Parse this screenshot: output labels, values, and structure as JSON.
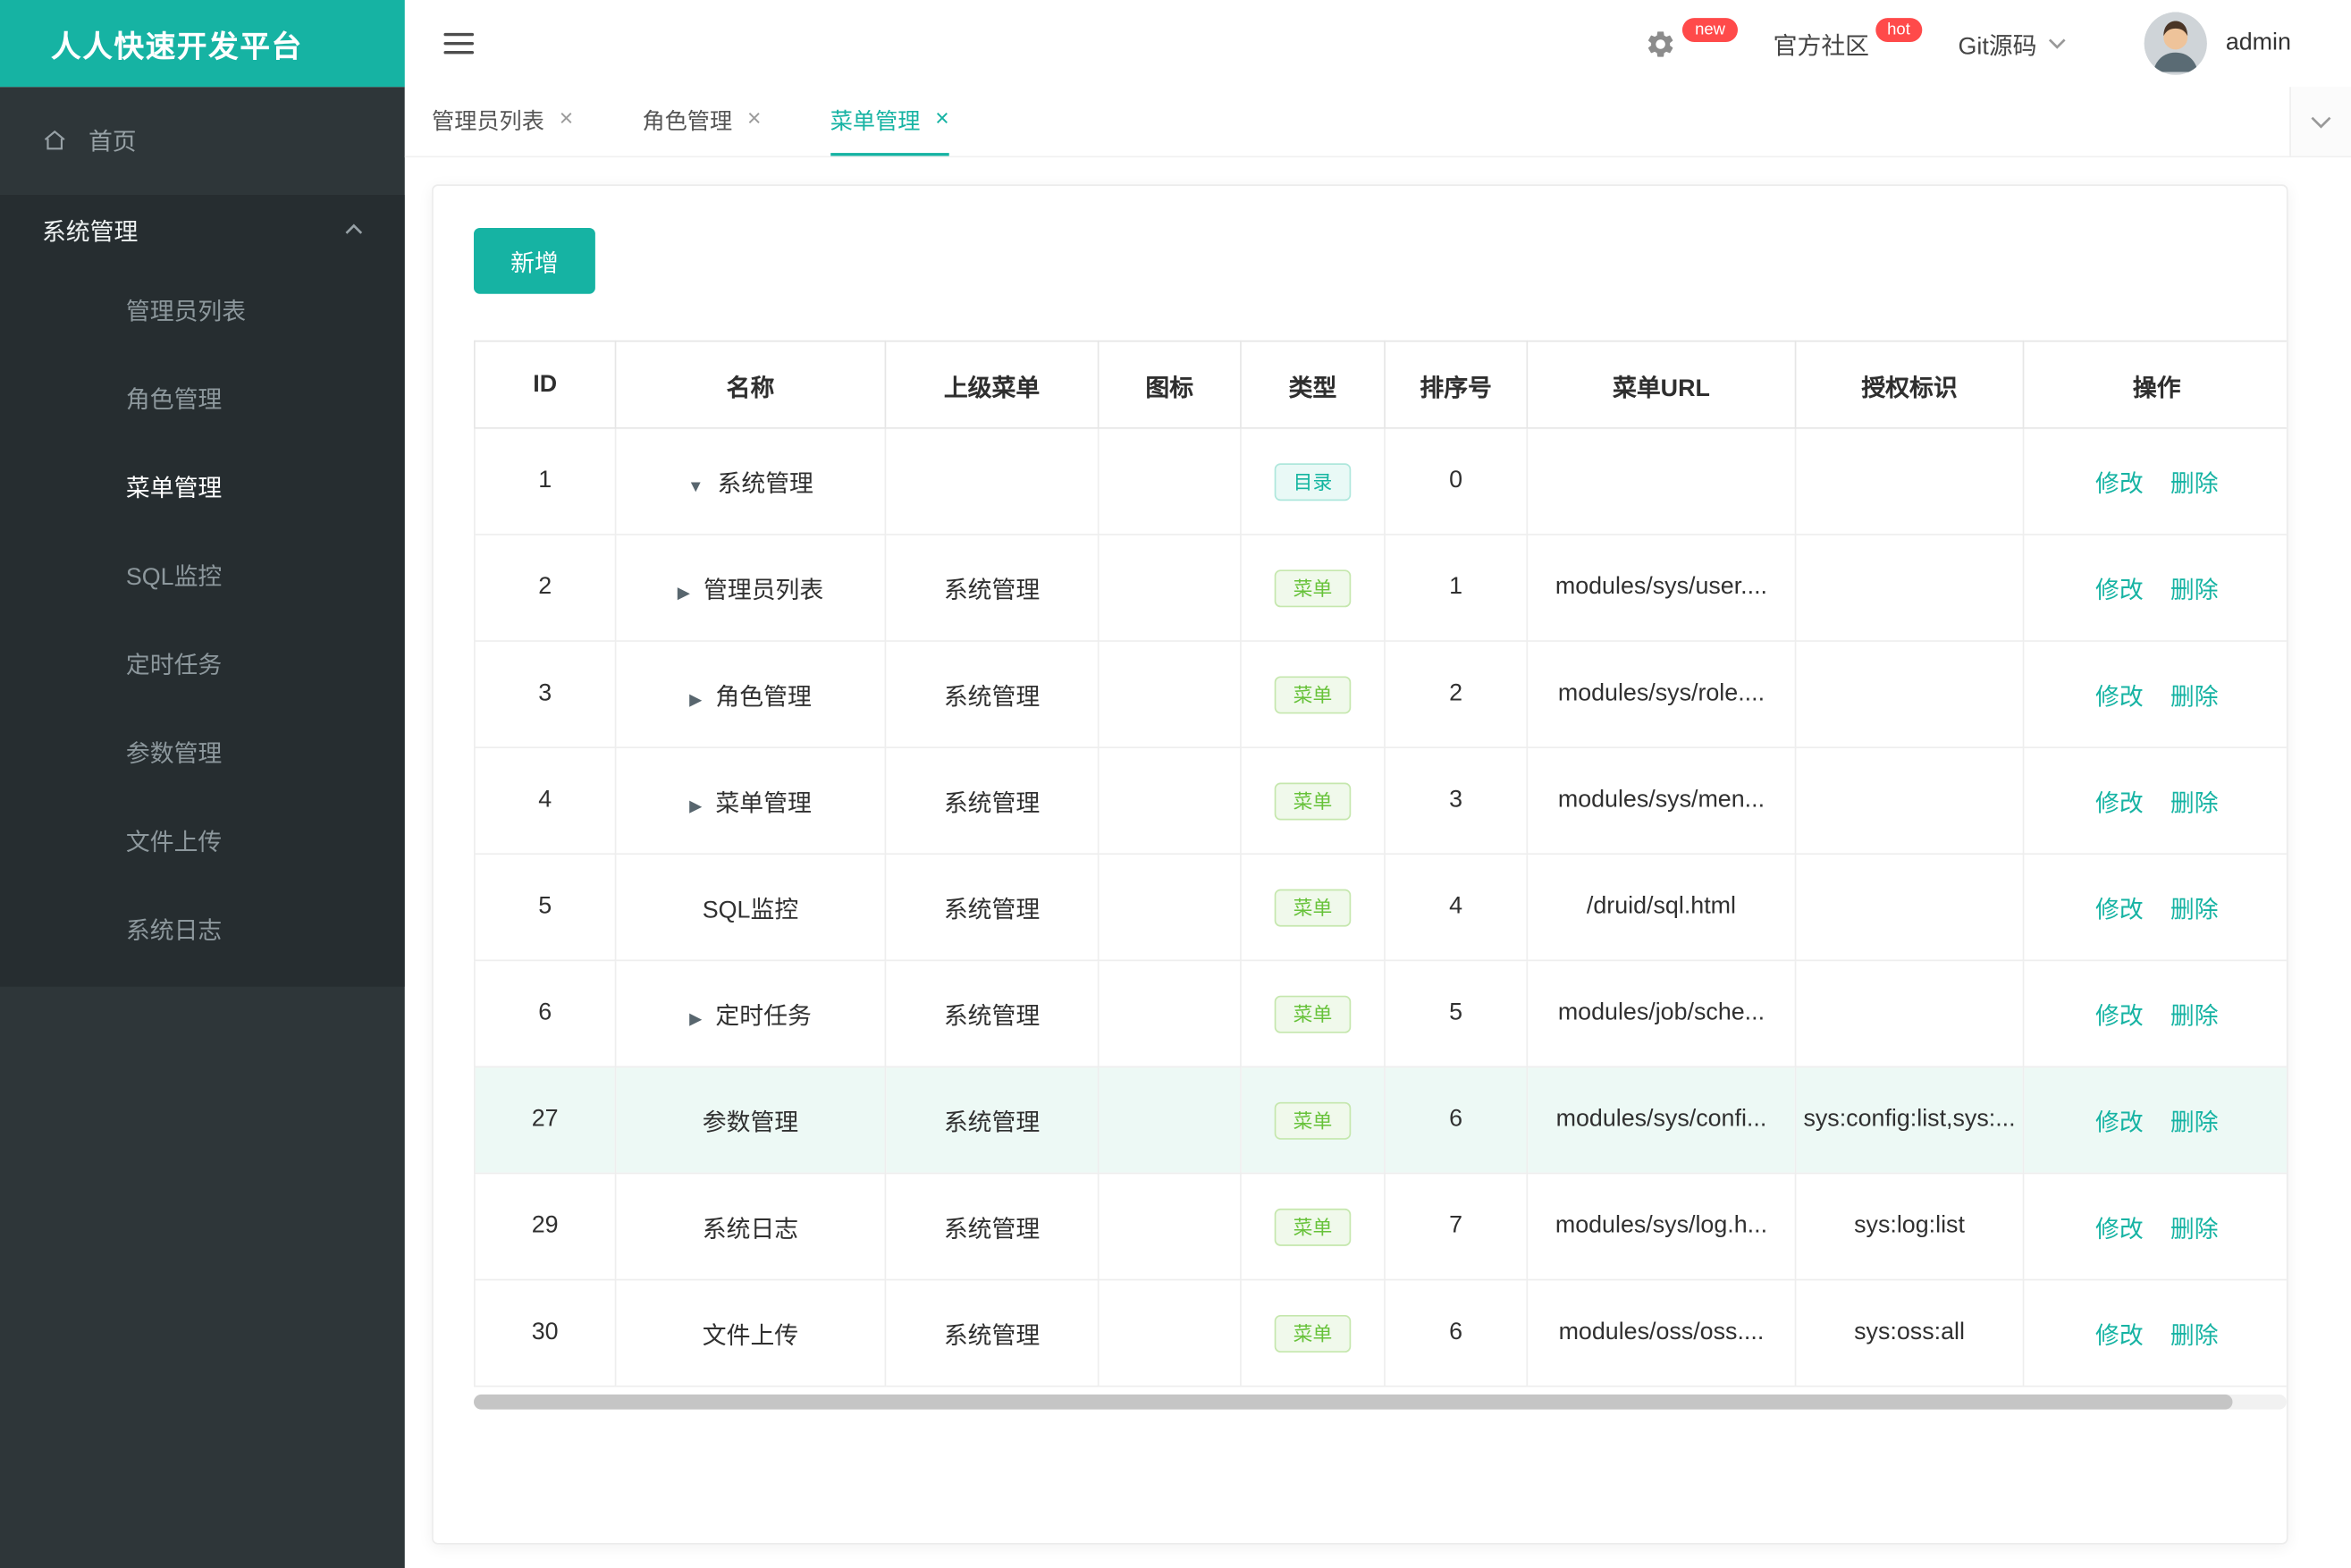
{
  "brand": {
    "title": "人人快速开发平台"
  },
  "header": {
    "badge_new": "new",
    "badge_hot": "hot",
    "community": "官方社区",
    "git": "Git源码",
    "username": "admin"
  },
  "tabs": [
    {
      "label": "管理员列表"
    },
    {
      "label": "角色管理"
    },
    {
      "label": "菜单管理"
    }
  ],
  "sidebar": {
    "home": "首页",
    "group": "系统管理",
    "items": [
      "管理员列表",
      "角色管理",
      "菜单管理",
      "SQL监控",
      "定时任务",
      "参数管理",
      "文件上传",
      "系统日志"
    ],
    "active_item": "菜单管理"
  },
  "toolbar": {
    "add_label": "新增"
  },
  "table": {
    "headers": [
      "ID",
      "名称",
      "上级菜单",
      "图标",
      "类型",
      "排序号",
      "菜单URL",
      "授权标识",
      "操作"
    ],
    "type_labels": {
      "dir": "目录",
      "menu": "菜单"
    },
    "actions": {
      "edit": "修改",
      "delete": "删除"
    },
    "rows": [
      {
        "id": "1",
        "arrow": "down",
        "name": "系统管理",
        "parent": "",
        "type": "dir",
        "order": "0",
        "url": "",
        "perms": ""
      },
      {
        "id": "2",
        "arrow": "right",
        "name": "管理员列表",
        "parent": "系统管理",
        "type": "menu",
        "order": "1",
        "url": "modules/sys/user....",
        "perms": ""
      },
      {
        "id": "3",
        "arrow": "right",
        "name": "角色管理",
        "parent": "系统管理",
        "type": "menu",
        "order": "2",
        "url": "modules/sys/role....",
        "perms": ""
      },
      {
        "id": "4",
        "arrow": "right",
        "name": "菜单管理",
        "parent": "系统管理",
        "type": "menu",
        "order": "3",
        "url": "modules/sys/men...",
        "perms": ""
      },
      {
        "id": "5",
        "arrow": "none",
        "name": "SQL监控",
        "parent": "系统管理",
        "type": "menu",
        "order": "4",
        "url": "/druid/sql.html",
        "perms": ""
      },
      {
        "id": "6",
        "arrow": "right",
        "name": "定时任务",
        "parent": "系统管理",
        "type": "menu",
        "order": "5",
        "url": "modules/job/sche...",
        "perms": ""
      },
      {
        "id": "27",
        "arrow": "none",
        "name": "参数管理",
        "parent": "系统管理",
        "type": "menu",
        "order": "6",
        "url": "modules/sys/confi...",
        "perms": "sys:config:list,sys:...",
        "highlight": true
      },
      {
        "id": "29",
        "arrow": "none",
        "name": "系统日志",
        "parent": "系统管理",
        "type": "menu",
        "order": "7",
        "url": "modules/sys/log.h...",
        "perms": "sys:log:list"
      },
      {
        "id": "30",
        "arrow": "none",
        "name": "文件上传",
        "parent": "系统管理",
        "type": "menu",
        "order": "6",
        "url": "modules/oss/oss....",
        "perms": "sys:oss:all"
      }
    ]
  },
  "icons": {
    "close": "×",
    "arrow_down": "▼",
    "arrow_right": "▶"
  },
  "colors": {
    "brand_teal": "#16b3a3",
    "badge_red": "#ff4a4a",
    "tag_dir": "#13b5a0",
    "tag_menu": "#67c23a",
    "sidebar_dark": "#2e3639",
    "sidebar_group_dark": "#262d30",
    "row_highlight": "#edf9f5"
  }
}
